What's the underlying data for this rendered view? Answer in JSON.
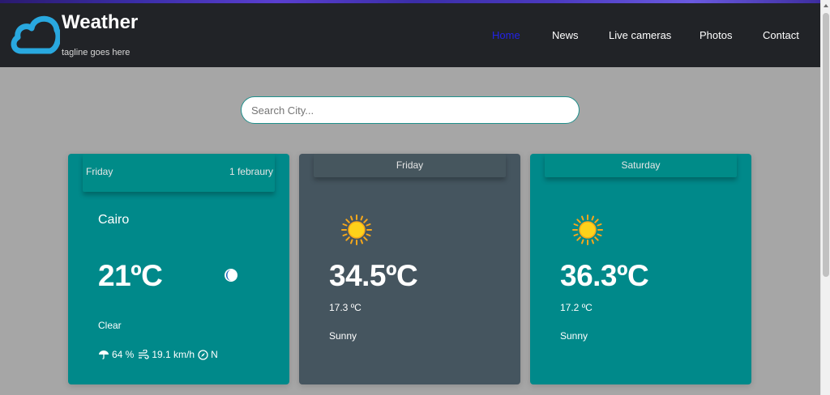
{
  "header": {
    "brand": "Weather",
    "tagline": "tagline goes here",
    "nav": [
      {
        "label": "Home",
        "active": true
      },
      {
        "label": "News",
        "active": false
      },
      {
        "label": "Live cameras",
        "active": false
      },
      {
        "label": "Photos",
        "active": false
      },
      {
        "label": "Contact",
        "active": false
      }
    ]
  },
  "search": {
    "placeholder": "Search City...",
    "value": ""
  },
  "cards": [
    {
      "day": "Friday",
      "date": "1 febraury",
      "city": "Cairo",
      "temp": "21ºC",
      "condition": "Clear",
      "humidity": "64 %",
      "wind_speed": "19.1 km/h",
      "wind_dir": "N",
      "icon": "moon-icon"
    },
    {
      "day": "Friday",
      "temp": "34.5ºC",
      "min_temp": "17.3 ºC",
      "condition": "Sunny",
      "icon": "sun-icon"
    },
    {
      "day": "Saturday",
      "temp": "36.3ºC",
      "min_temp": "17.2 ºC",
      "condition": "Sunny",
      "icon": "sun-icon"
    }
  ],
  "colors": {
    "header_bg": "#212327",
    "page_bg": "#a6a6a6",
    "card_teal": "#00898a",
    "card_slate": "#45555f",
    "nav_active": "#2323e6",
    "logo_blue": "#29a8df"
  }
}
